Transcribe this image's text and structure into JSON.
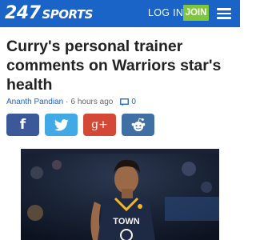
{
  "header": {
    "logo_number": "247",
    "logo_word": "SPORTS",
    "login_label": "LOG IN",
    "join_label": "JOIN",
    "menu_icon": "hamburger-menu-icon",
    "brand_color": "#1a63c7",
    "join_color": "#7ec73b"
  },
  "article": {
    "headline": "Curry's personal trainer comments on Warriors star's health",
    "author": "Ananth Pandian",
    "separator": "·",
    "time": "6 hours ago",
    "comment_count": "0"
  },
  "share": {
    "facebook": {
      "icon": "facebook-icon",
      "glyph": "f",
      "color": "#3b5998"
    },
    "twitter": {
      "icon": "twitter-icon",
      "color": "#41a9e6"
    },
    "googleplus": {
      "icon": "google-plus-icon",
      "glyph": "g+",
      "color": "#d34836"
    },
    "reddit": {
      "icon": "reddit-icon",
      "color": "#3f6fa3"
    }
  },
  "photo": {
    "jersey_text": "TOWN"
  }
}
